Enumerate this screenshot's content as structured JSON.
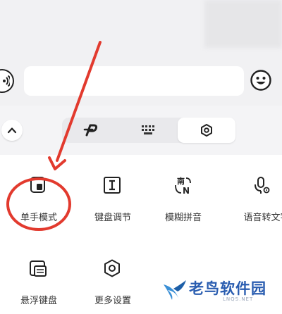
{
  "keyboard_panel": {
    "items": [
      {
        "label": "单手模式",
        "icon": "one-hand-icon"
      },
      {
        "label": "键盘调节",
        "icon": "resize-icon"
      },
      {
        "label": "模糊拼音",
        "icon": "fuzzy-pinyin-icon"
      },
      {
        "label": "语音转文字",
        "icon": "voice-to-text-icon"
      },
      {
        "label": "悬浮键盘",
        "icon": "floating-keyboard-icon"
      },
      {
        "label": "更多设置",
        "icon": "hexagon-settings-icon"
      }
    ],
    "fuzzy_icon_glyphs": {
      "top": "南",
      "bottom": "N"
    }
  },
  "toolbar": {
    "tabs": [
      {
        "icon": "swipe-p-icon",
        "active": false
      },
      {
        "icon": "keyboard-icon",
        "active": false
      },
      {
        "icon": "hexagon-settings-icon",
        "active": true
      }
    ]
  },
  "annotation": {
    "color": "#e23a2e"
  },
  "watermark": {
    "title": "老鸟软件园",
    "url": "LNQS.NET"
  }
}
